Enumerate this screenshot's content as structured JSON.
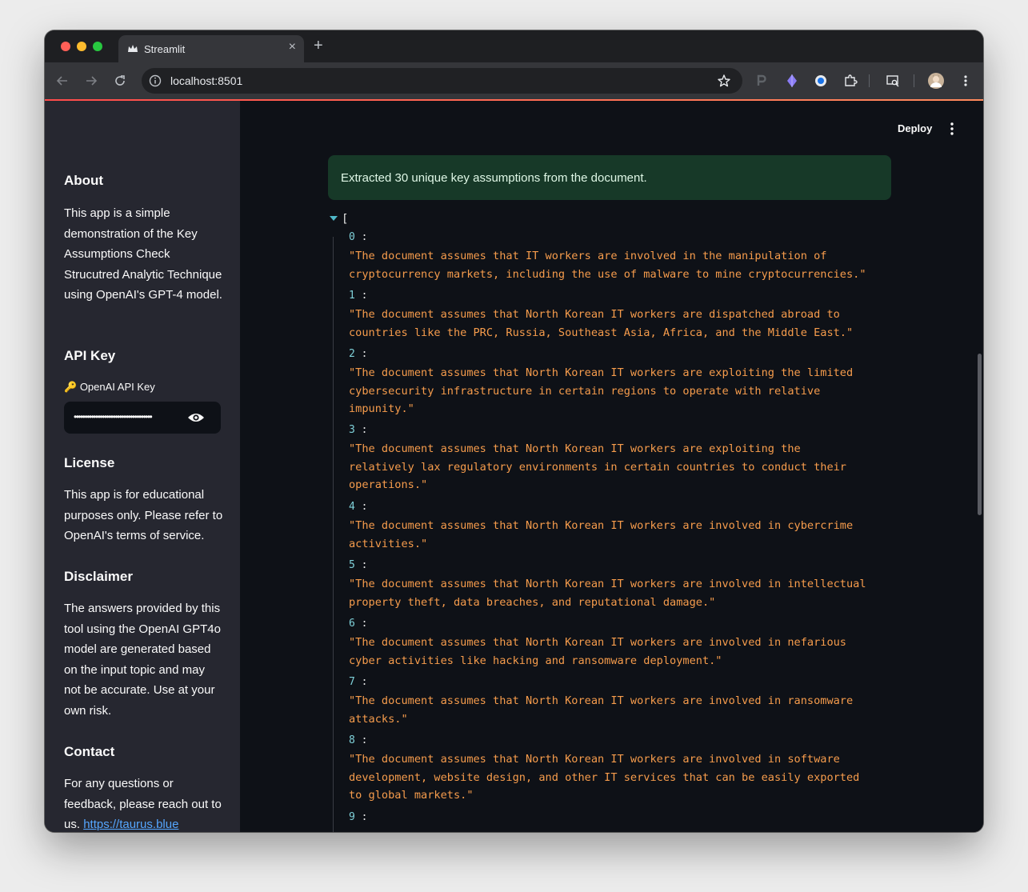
{
  "browser": {
    "tab_title": "Streamlit",
    "url": "localhost:8501",
    "new_tab_label": "+",
    "close_tab_label": "×"
  },
  "sidebar": {
    "about": {
      "heading": "About",
      "text": "This app is a simple demonstration of the Key Assumptions Check Strucutred Analytic Technique using OpenAI's GPT-4 model."
    },
    "api_key": {
      "heading": "API Key",
      "label": "OpenAI API Key",
      "label_icon": "🔑",
      "value": "••••••••••••••••••••••••••••••••••••"
    },
    "license": {
      "heading": "License",
      "text": "This app is for educational purposes only. Please refer to OpenAI's terms of service."
    },
    "disclaimer": {
      "heading": "Disclaimer",
      "text": "The answers provided by this tool using the OpenAI GPT4o model are generated based on the input topic and may not be accurate. Use at your own risk."
    },
    "contact": {
      "heading": "Contact",
      "text": "For any questions or feedback, please reach out to us. ",
      "link": "https://taurus.blue"
    }
  },
  "header": {
    "deploy_label": "Deploy"
  },
  "success_message": "Extracted 30 unique key assumptions from the document.",
  "json_viewer": {
    "open_bracket": "[",
    "colon": ":",
    "items": [
      {
        "index": "0",
        "value": "\"The document assumes that IT workers are involved in the manipulation of\ncryptocurrency markets, including the use of malware to mine cryptocurrencies.\""
      },
      {
        "index": "1",
        "value": "\"The document assumes that North Korean IT workers are dispatched abroad to\ncountries like the PRC, Russia, Southeast Asia, Africa, and the Middle East.\""
      },
      {
        "index": "2",
        "value": "\"The document assumes that North Korean IT workers are exploiting the limited\ncybersecurity infrastructure in certain regions to operate with relative\nimpunity.\""
      },
      {
        "index": "3",
        "value": "\"The document assumes that North Korean IT workers are exploiting the\nrelatively lax regulatory environments in certain countries to conduct their\noperations.\""
      },
      {
        "index": "4",
        "value": "\"The document assumes that North Korean IT workers are involved in cybercrime\nactivities.\""
      },
      {
        "index": "5",
        "value": "\"The document assumes that North Korean IT workers are involved in intellectual\nproperty theft, data breaches, and reputational damage.\""
      },
      {
        "index": "6",
        "value": "\"The document assumes that North Korean IT workers are involved in nefarious\ncyber activities like hacking and ransomware deployment.\""
      },
      {
        "index": "7",
        "value": "\"The document assumes that North Korean IT workers are involved in ransomware\nattacks.\""
      },
      {
        "index": "8",
        "value": "\"The document assumes that North Korean IT workers are involved in software\ndevelopment, website design, and other IT services that can be easily exported\nto global markets.\""
      },
      {
        "index": "9",
        "value": ""
      }
    ]
  }
}
